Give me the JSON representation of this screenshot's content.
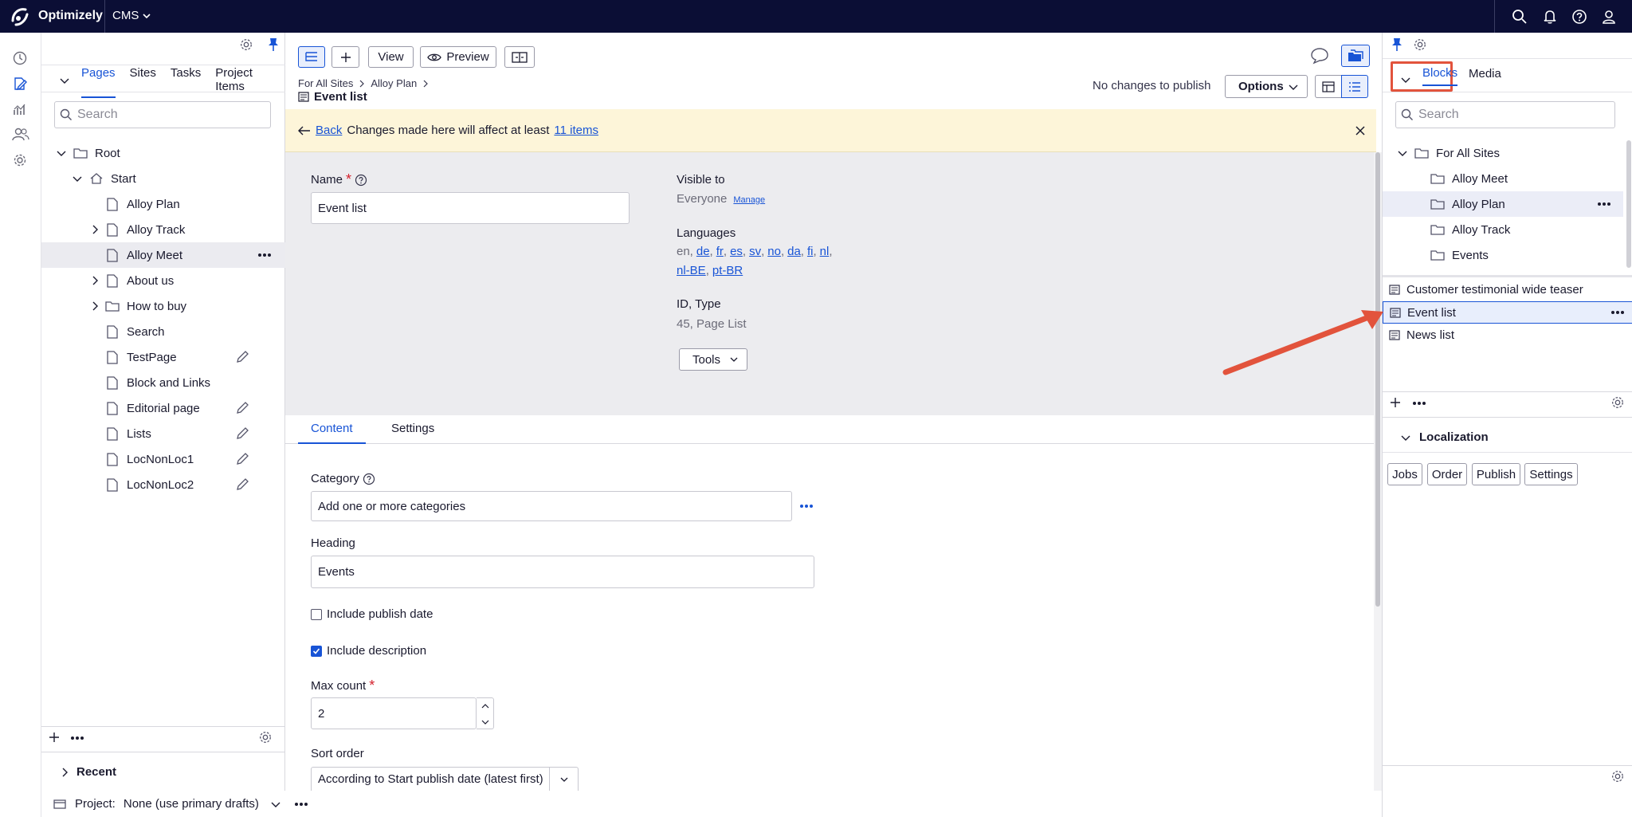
{
  "topbar": {
    "brand": "Optimizely",
    "product": "CMS"
  },
  "left_pane": {
    "tabs": [
      "Pages",
      "Sites",
      "Tasks",
      "Project Items"
    ],
    "search_placeholder": "Search",
    "tree": [
      {
        "label": "Root"
      },
      {
        "label": "Start"
      },
      {
        "label": "Alloy Plan"
      },
      {
        "label": "Alloy Track"
      },
      {
        "label": "Alloy Meet"
      },
      {
        "label": "About us"
      },
      {
        "label": "How to buy"
      },
      {
        "label": "Search"
      },
      {
        "label": "TestPage"
      },
      {
        "label": "Block and Links"
      },
      {
        "label": "Editorial page"
      },
      {
        "label": "Lists"
      },
      {
        "label": "LocNonLoc1"
      },
      {
        "label": "LocNonLoc2"
      }
    ],
    "recent_label": "Recent",
    "project_label": "Project:",
    "project_value": "None (use primary drafts)"
  },
  "toolbar": {
    "view": "View",
    "preview": "Preview"
  },
  "breadcrumb": {
    "items": [
      "For All Sites",
      "Alloy Plan"
    ],
    "current": "Event list"
  },
  "publish_status": "No changes to publish",
  "options_label": "Options",
  "notice": {
    "back": "Back",
    "text": "Changes made here will affect at least",
    "link": "11 items"
  },
  "info": {
    "name_label": "Name",
    "name_value": "Event list",
    "visible_label": "Visible to",
    "visible_value": "Everyone",
    "manage": "Manage",
    "languages_label": "Languages",
    "lang_plain": "en,",
    "lang_links_1": [
      "de",
      "fr",
      "es",
      "sv",
      "no",
      "da",
      "fi",
      "nl"
    ],
    "lang_links_2": [
      "nl-BE",
      "pt-BR"
    ],
    "id_label": "ID, Type",
    "id_value": "45, Page List",
    "tools": "Tools"
  },
  "content_tabs": [
    "Content",
    "Settings"
  ],
  "form": {
    "category_label": "Category",
    "category_placeholder": "Add one or more categories",
    "heading_label": "Heading",
    "heading_value": "Events",
    "publish_date_label": "Include publish date",
    "description_label": "Include description",
    "max_count_label": "Max count",
    "max_count_value": "2",
    "sort_label": "Sort order",
    "sort_value": "According to Start publish date (latest first)"
  },
  "right_pane": {
    "tabs": [
      "Blocks",
      "Media"
    ],
    "search_placeholder": "Search",
    "folders": [
      "For All Sites",
      "Alloy Meet",
      "Alloy Plan",
      "Alloy Track",
      "Events"
    ],
    "blocks": [
      "Customer testimonial wide teaser",
      "Event list",
      "News list"
    ],
    "localization_label": "Localization",
    "loc_buttons": [
      "Jobs",
      "Order",
      "Publish",
      "Settings"
    ]
  },
  "colors": {
    "accent": "#1854d6",
    "topbar": "#0b0e35",
    "highlight": "#e2533c",
    "notice_bg": "#fdf5d9"
  }
}
